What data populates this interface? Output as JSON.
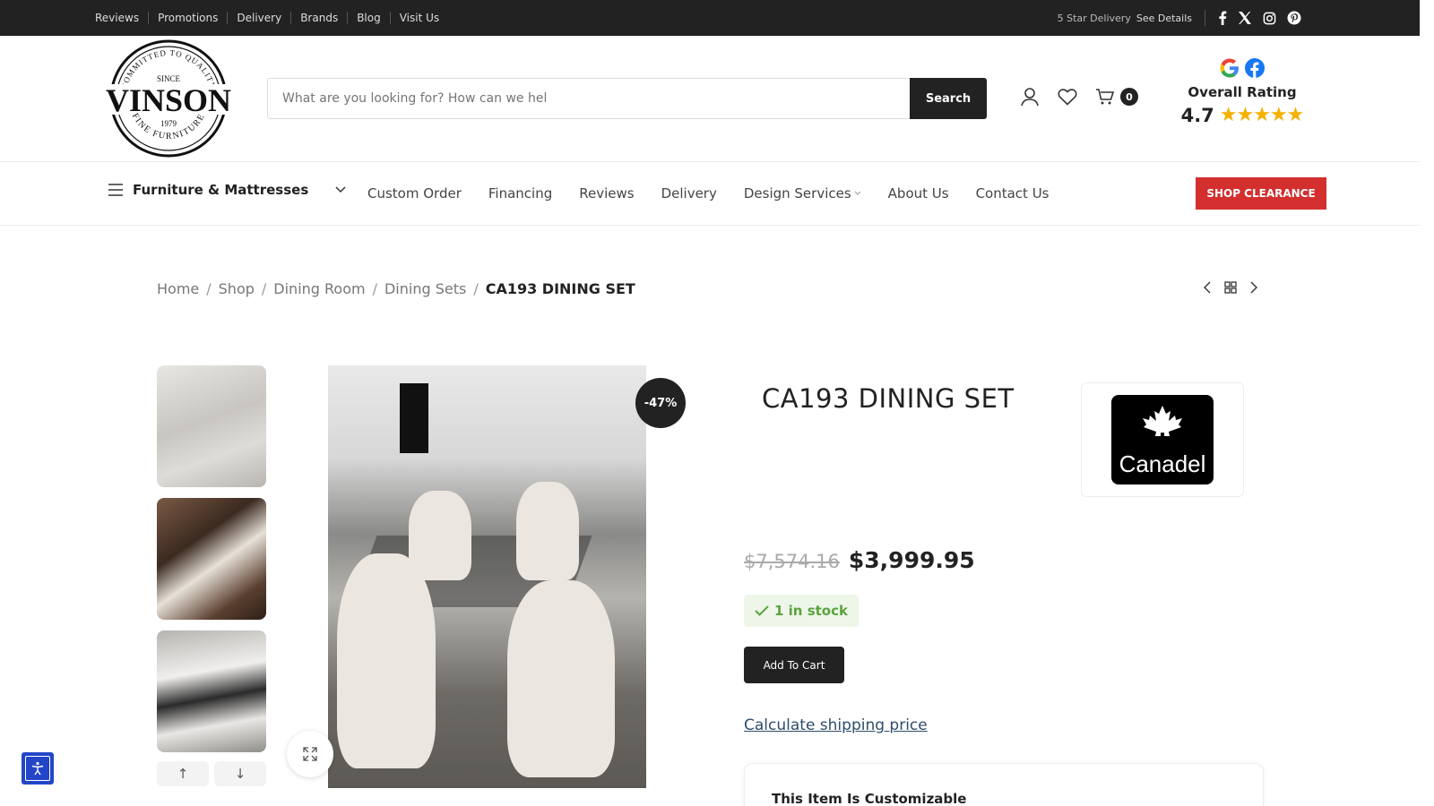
{
  "topbar": {
    "links": [
      "Reviews",
      "Promotions",
      "Delivery",
      "Brands",
      "Blog",
      "Visit Us"
    ],
    "delivery_text": "5 Star Delivery",
    "delivery_link": "See Details",
    "social_icons": [
      "facebook-icon",
      "x-icon",
      "instagram-icon",
      "pinterest-icon"
    ]
  },
  "logo": {
    "name": "VINSON",
    "arc_top": "COMMITTED TO QUALITY",
    "since": "SINCE",
    "year": "1979",
    "arc_bottom": "FINE FURNITURE"
  },
  "search": {
    "placeholder": "What are you looking for? How can we hel",
    "button": "Search"
  },
  "header": {
    "cart_count": "0"
  },
  "rating": {
    "title": "Overall Rating",
    "score": "4.7",
    "stars": 5
  },
  "nav": {
    "category": "Furniture & Mattresses",
    "items": [
      "Custom Order",
      "Financing",
      "Reviews",
      "Delivery",
      "Design Services",
      "About Us",
      "Contact Us"
    ],
    "clearance": "SHOP CLEARANCE"
  },
  "breadcrumb": [
    "Home",
    "Shop",
    "Dining Room",
    "Dining Sets",
    "CA193 DINING SET"
  ],
  "product": {
    "title": "CA193 DINING SET",
    "discount": "-47%",
    "old_price": "$7,574.16",
    "price": "$3,999.95",
    "stock": "1 in stock",
    "add_to_cart": "Add To Cart",
    "shipping_link": "Calculate shipping price",
    "custom_title": "This Item Is Customizable",
    "brand": "Canadel"
  },
  "gallery": {
    "arrow_up": "↑",
    "arrow_down": "↓"
  },
  "colors": {
    "dark": "#222222",
    "accent_red": "#d32f2f",
    "stock_green": "#5aa33f",
    "star": "#f5b100"
  }
}
